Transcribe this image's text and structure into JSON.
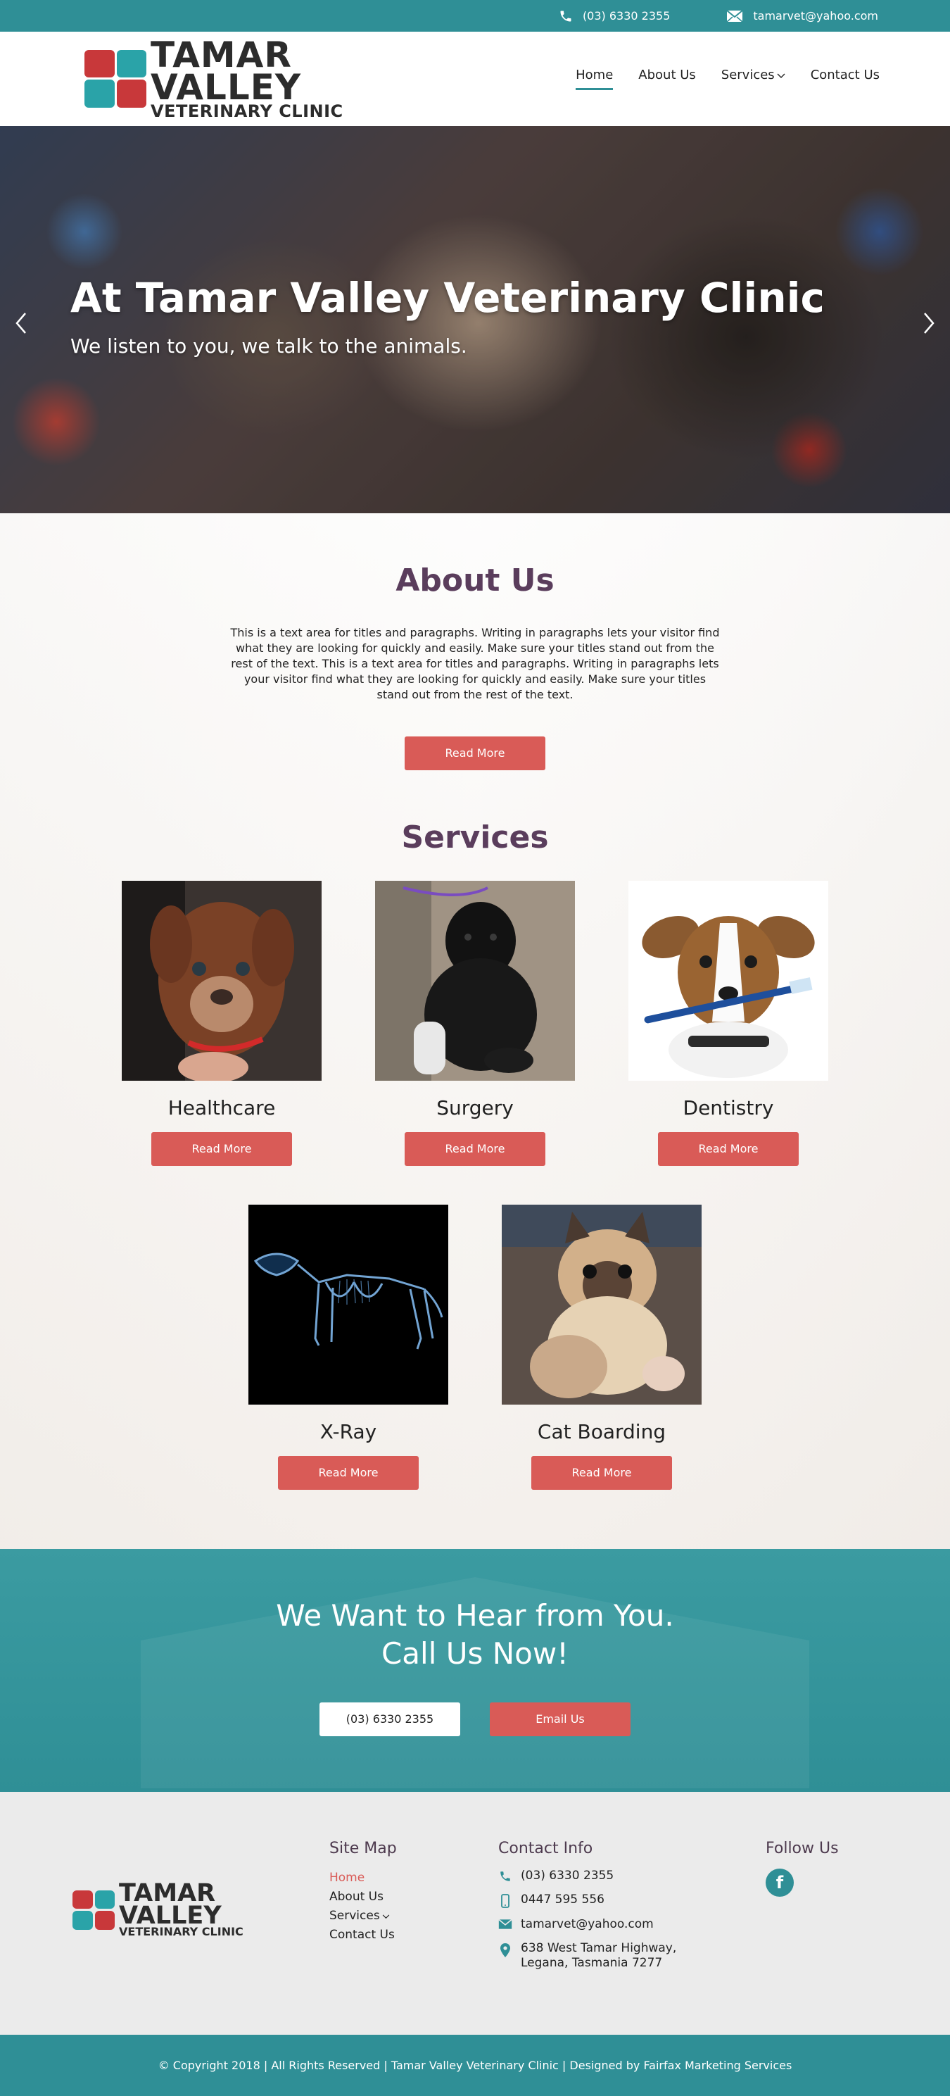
{
  "topbar": {
    "phone": "(03) 6330 2355",
    "email": "tamarvet@yahoo.com"
  },
  "brand": {
    "line1": "TAMAR",
    "line2": "VALLEY",
    "line3": "VETERINARY CLINIC",
    "colors": {
      "red": "#c8383a",
      "teal": "#2aa3a8",
      "dark": "#2c2c2c"
    }
  },
  "nav": {
    "items": [
      {
        "label": "Home",
        "active": true
      },
      {
        "label": "About Us"
      },
      {
        "label": "Services",
        "has_dropdown": true
      },
      {
        "label": "Contact Us"
      }
    ]
  },
  "hero": {
    "title": "At Tamar Valley Veterinary Clinic",
    "subtitle": "We listen to you, we talk to the animals."
  },
  "about": {
    "title": "About Us",
    "text": "This is a text area for titles and paragraphs. Writing in paragraphs lets your visitor find what they are looking for quickly and easily. Make sure your titles stand out from the rest of the text. This is a text area for titles and paragraphs. Writing in paragraphs lets your visitor find what they are looking for quickly and easily. Make sure your titles stand out from the rest of the text.",
    "button": "Read More"
  },
  "services": {
    "title": "Services",
    "items": [
      {
        "name": "Healthcare",
        "button": "Read More"
      },
      {
        "name": "Surgery",
        "button": "Read More"
      },
      {
        "name": "Dentistry",
        "button": "Read More"
      },
      {
        "name": "X-Ray",
        "button": "Read More"
      },
      {
        "name": "Cat Boarding",
        "button": "Read More"
      }
    ]
  },
  "cta": {
    "line1": "We Want to Hear from You.",
    "line2": "Call Us Now!",
    "phone_button": "(03) 6330 2355",
    "email_button": "Email Us"
  },
  "footer": {
    "sitemap_title": "Site Map",
    "sitemap": [
      "Home",
      "About Us",
      "Services",
      "Contact Us"
    ],
    "contact_title": "Contact Info",
    "phone": "(03) 6330 2355",
    "mobile": "0447 595 556",
    "email": "tamarvet@yahoo.com",
    "address_line1": "638 West Tamar Highway,",
    "address_line2": "Legana, Tasmania 7277",
    "follow_title": "Follow Us",
    "facebook_glyph": "f"
  },
  "copyright": "© Copyright 2018 | All Rights Reserved | Tamar Valley Veterinary Clinic | Designed by Fairfax Marketing Services",
  "accent_colors": {
    "teal": "#2f8f96",
    "button_red": "#d95b57",
    "heading_purple": "#5a3d5c"
  }
}
